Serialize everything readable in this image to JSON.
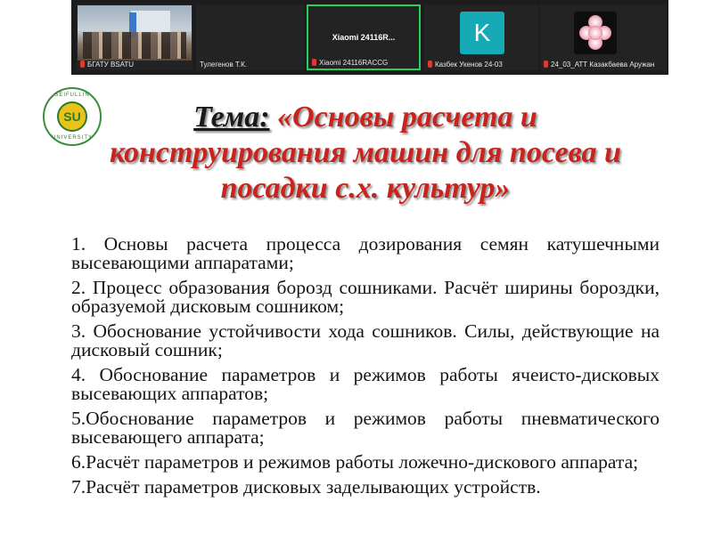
{
  "conference": {
    "accent_active": "#23d160",
    "tiles": [
      {
        "label": "БГАТУ BSATU",
        "muted": true,
        "kind": "video"
      },
      {
        "label": "Тулегенов Т.К.",
        "muted": false,
        "kind": "blank"
      },
      {
        "label": "Xiaomi 24116RACCG",
        "name": "Xiaomi 24116R...",
        "muted": true,
        "kind": "name",
        "active": true
      },
      {
        "label": "Казбек Укенов 24-03",
        "muted": true,
        "kind": "avatar",
        "avatar_letter": "K",
        "avatar_color": "#16a9b6"
      },
      {
        "label": "24_03_АТТ Казакбаева Аружан",
        "muted": true,
        "kind": "flower"
      }
    ]
  },
  "slide": {
    "logo": {
      "top_text": "SEIFULLIN",
      "bottom_text": "UNIVERSITY",
      "monogram": "SU"
    },
    "title_lead": "Тема:",
    "title_rest": " «Основы расчета и конструирования машин для посева и посадки с.х. культур»",
    "title_color": "#c8241d",
    "items": [
      "1. Основы расчета процесса дозирования семян катушечными высевающими аппаратами;",
      "2. Процесс образования борозд сошниками. Расчёт ширины бороздки, образуемой дисковым сошником;",
      "3. Обоснование устойчивости хода сошников. Силы, действующие на дисковый сошник;",
      "4. Обоснование параметров и режимов работы ячеисто-дисковых высевающих аппаратов;",
      "5.Обоснование параметров и режимов работы пневматического высевающего аппарата;",
      "6.Расчёт параметров и режимов работы ложечно-дискового аппарата;",
      "7.Расчёт параметров дисковых заделывающих устройств."
    ]
  }
}
